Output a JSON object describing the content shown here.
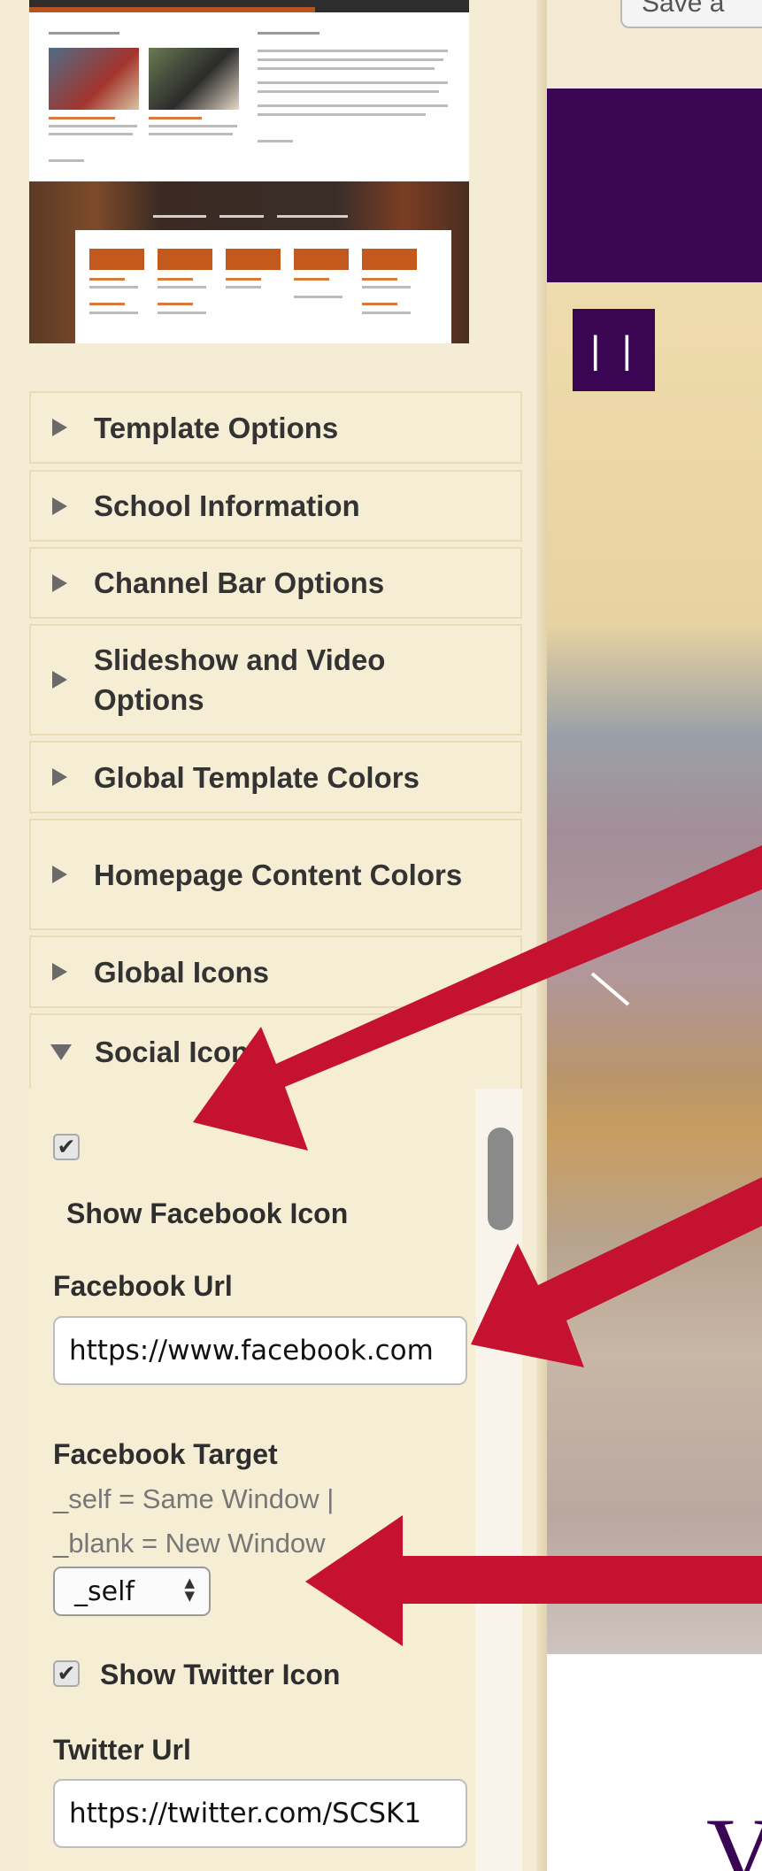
{
  "accordion": {
    "items": [
      {
        "label": "Template Options"
      },
      {
        "label": "School Information"
      },
      {
        "label": "Channel Bar Options"
      },
      {
        "label": "Slideshow and Video Options"
      },
      {
        "label": "Global Template Colors"
      },
      {
        "label": "Homepage Content Colors"
      },
      {
        "label": "Global Icons"
      },
      {
        "label": "Social Icons"
      }
    ]
  },
  "social": {
    "facebook_checkbox_mark": "✔",
    "show_facebook_label": "Show Facebook Icon",
    "facebook_url_label": "Facebook Url",
    "facebook_url_value": "https://www.facebook.com",
    "facebook_target_label": "Facebook Target",
    "facebook_target_hint_1": "_self = Same Window |",
    "facebook_target_hint_2": "_blank = New Window",
    "facebook_target_value": "_self",
    "twitter_checkbox_mark": "✔",
    "show_twitter_label": "Show Twitter Icon",
    "twitter_url_label": "Twitter Url",
    "twitter_url_value": "https://twitter.com/SCSK1"
  },
  "right": {
    "save_button_label": "Save a",
    "pause_icon_glyph": "| |",
    "bottom_heading_fragment": "V"
  },
  "colors": {
    "panel_bg": "#f5ecd6",
    "banner_purple": "#3a0653",
    "arrow_red": "#c41230",
    "preview_orange": "#c4591d"
  },
  "icons": {
    "collapsed": "triangle-right-icon",
    "expanded": "triangle-down-icon",
    "checkbox": "checkmark-icon",
    "select": "up-down-arrows-icon",
    "pause": "pause-icon"
  }
}
